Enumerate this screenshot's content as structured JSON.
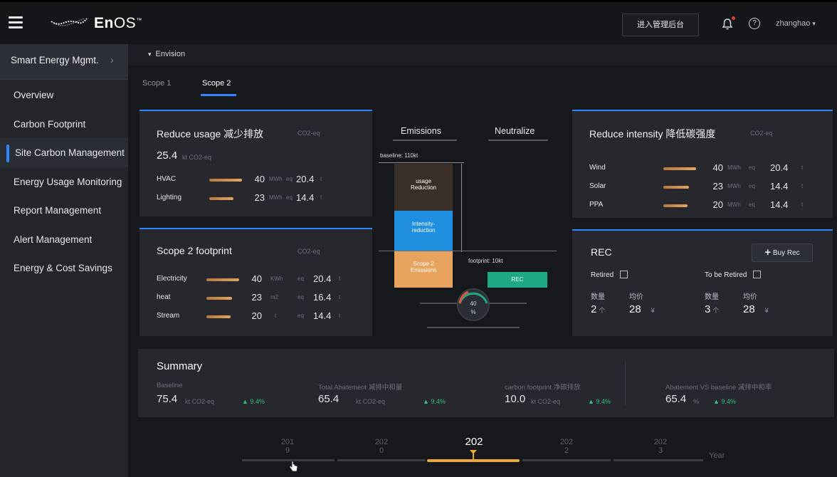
{
  "header": {
    "logo_text_bold": "En",
    "logo_text_rest": "OS",
    "logo_tm": "™",
    "admin_button": "进入管理后台",
    "user": "zhanghao",
    "user_chevron": "▾",
    "icons": [
      "menu-icon",
      "envision-logo-icon",
      "bell-icon",
      "help-icon",
      "chevron-down-icon"
    ]
  },
  "sidebar": {
    "head": "Smart Energy Mgmt.",
    "head_chevron": "›",
    "items": [
      {
        "label": "Overview",
        "active": false
      },
      {
        "label": "Carbon Footprint",
        "active": false
      },
      {
        "label": "Site Carbon Management",
        "active": true
      },
      {
        "label": "Energy  Usage Monitoring",
        "active": false
      },
      {
        "label": "Report Management",
        "active": false
      },
      {
        "label": "Alert Management",
        "active": false
      },
      {
        "label": "Energy & Cost Savings",
        "active": false
      }
    ]
  },
  "breadcrumb": {
    "chevron": "▾",
    "label": "Envision"
  },
  "tabs": [
    {
      "label": "Scope 1",
      "active": false
    },
    {
      "label": "Scope 2",
      "active": true
    }
  ],
  "reduce_usage": {
    "title": "Reduce usage 减少排放",
    "unit": "CO2-eq",
    "total": "25.4",
    "total_unit": "kt CO2-eq",
    "rows": [
      {
        "label": "HVAC",
        "num": "40",
        "unit": "MWh",
        "eq": "eq",
        "val": "20.4",
        "t": "t"
      },
      {
        "label": "Lighting",
        "num": "23",
        "unit": "MWh",
        "eq": "eq",
        "val": "14.4",
        "t": "t"
      }
    ]
  },
  "scope2_footprint": {
    "title": "Scope 2 footprint",
    "unit": "CO2-eq",
    "rows": [
      {
        "label": "Electricity",
        "num": "40",
        "unit": "KWh",
        "eq": "eq",
        "val": "20.4",
        "t": "t"
      },
      {
        "label": "heat",
        "num": "23",
        "unit": "m2",
        "eq": "eq",
        "val": "16.4",
        "t": "t"
      },
      {
        "label": "Stream",
        "num": "20",
        "unit": "t",
        "eq": "eq",
        "val": "14.4",
        "t": "t"
      }
    ]
  },
  "diagram": {
    "tab_emissions": "Emissions",
    "tab_neutralize": "Neutralize",
    "baseline": "baseline: 110kt",
    "footprint": "footprint: 10kt",
    "block_usage": "usage\nReduction",
    "block_intensity": "Intensity-\nreduction",
    "block_scope": "Scope 2\nEmissions",
    "block_rec": "REC",
    "gauge_value": "40",
    "gauge_unit": "%",
    "colors": {
      "usage": "#3a2e28",
      "intensity": "#1f8fe0",
      "scope": "#e8a35f",
      "rec": "#1fa886"
    }
  },
  "reduce_intensity": {
    "title": "Reduce intensity 降低碳强度",
    "unit": "CO2-eq",
    "rows": [
      {
        "label": "Wind",
        "num": "40",
        "unit": "MWh",
        "eq": "eq",
        "val": "20.4",
        "t": "t"
      },
      {
        "label": "Solar",
        "num": "23",
        "unit": "MWh",
        "eq": "eq",
        "val": "14.4",
        "t": "t"
      },
      {
        "label": "PPA",
        "num": "20",
        "unit": "MWh",
        "eq": "eq",
        "val": "14.4",
        "t": "t"
      }
    ]
  },
  "rec": {
    "title": "REC",
    "buy_plus": "+",
    "buy": "Buy Rec",
    "retired": "Retired",
    "to_be_retired": "To be Retired",
    "qty_label": "数量",
    "price_label": "均价",
    "retired_qty": "2",
    "retired_qty_unit": "个",
    "retired_price": "28",
    "retired_price_unit": "¥",
    "tbr_qty": "3",
    "tbr_qty_unit": "个",
    "tbr_price": "28",
    "tbr_price_unit": "¥"
  },
  "summary": {
    "title": "Summary",
    "items": [
      {
        "label": "Baseline",
        "value": "75.4",
        "unit": "kt CO2-eq",
        "pct": "▲ 9.4%"
      },
      {
        "label": "Total Abatement 减排中和量",
        "value": "65.4",
        "unit": "kt CO2-eq",
        "pct": "▲ 9.4%"
      },
      {
        "label": "carbon footprint 净碳排放",
        "value": "10.0",
        "unit": "kt CO2-eq",
        "pct": "▲ 9.4%"
      },
      {
        "label": "Abatement VS baseline 减排中和率",
        "value": "65.4",
        "unit": "%",
        "pct": "▲ 9.4%"
      }
    ]
  },
  "timeline": {
    "years": [
      {
        "top": "201",
        "bottom": "9",
        "selected": false
      },
      {
        "top": "202",
        "bottom": "0",
        "selected": false
      },
      {
        "top": "202",
        "bottom": "1",
        "selected": true
      },
      {
        "top": "202",
        "bottom": "2",
        "selected": false
      },
      {
        "top": "202",
        "bottom": "3",
        "selected": false
      }
    ],
    "axis_label": "Year"
  }
}
